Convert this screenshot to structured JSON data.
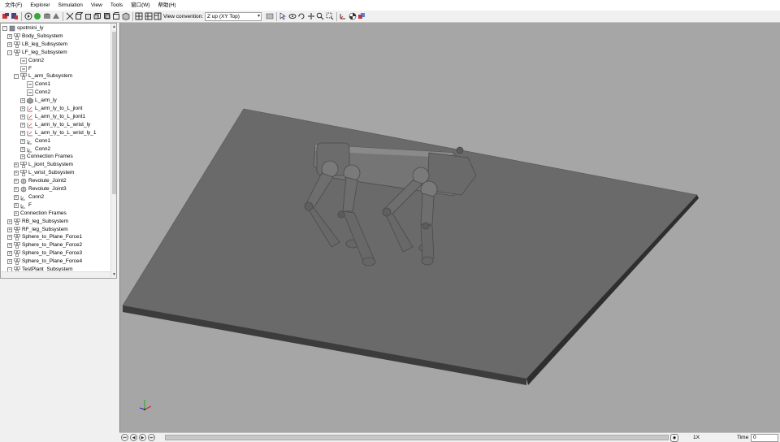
{
  "menu": [
    {
      "label": "文件(F)"
    },
    {
      "label": "Explorer"
    },
    {
      "label": "Simulation"
    },
    {
      "label": "View"
    },
    {
      "label": "Tools"
    },
    {
      "label": "窗口(W)"
    },
    {
      "label": "帮助(H)"
    }
  ],
  "toolbar": {
    "view_convention_label": "View convention:",
    "view_convention_value": "Z up (XY Top)"
  },
  "tree": [
    {
      "label": "spotmini_ly",
      "icon": "model-icon",
      "expander": "-"
    },
    {
      "label": "Body_Subsystem",
      "icon": "subsystem-icon",
      "expander": "+"
    },
    {
      "label": "LB_leg_Subsystem",
      "icon": "subsystem-icon",
      "expander": "+"
    },
    {
      "label": "LF_leg_Subsystem",
      "icon": "subsystem-icon",
      "expander": "-"
    },
    {
      "label": "Conn2",
      "icon": "port-icon",
      "expander": ""
    },
    {
      "label": "F",
      "icon": "port-icon",
      "expander": ""
    },
    {
      "label": "L_arm_Subsystem",
      "icon": "subsystem-icon",
      "expander": "-"
    },
    {
      "label": "Conn1",
      "icon": "port-icon",
      "expander": ""
    },
    {
      "label": "Conn2",
      "icon": "port-icon",
      "expander": ""
    },
    {
      "label": "L_arm_ly",
      "icon": "solid-icon",
      "expander": "+"
    },
    {
      "label": "L_arm_ly_to_L_jiont",
      "icon": "transform-icon",
      "expander": "+"
    },
    {
      "label": "L_arm_ly_to_L_jiont1",
      "icon": "transform-icon",
      "expander": "+"
    },
    {
      "label": "L_arm_ly_to_L_wrist_ly",
      "icon": "transform-icon",
      "expander": "+"
    },
    {
      "label": "L_arm_ly_to_L_wrist_ly_1",
      "icon": "transform-icon",
      "expander": "+"
    },
    {
      "label": "Conn1",
      "icon": "frame-icon",
      "expander": "+"
    },
    {
      "label": "Conn2",
      "icon": "frame-icon",
      "expander": "+"
    },
    {
      "label": "Connection Frames",
      "icon": "",
      "expander": "+"
    },
    {
      "label": "L_jiont_Subsystem",
      "icon": "subsystem-icon",
      "expander": "+"
    },
    {
      "label": "L_wrist_Subsystem",
      "icon": "subsystem-icon",
      "expander": "+"
    },
    {
      "label": "Revolute_Joint2",
      "icon": "joint-icon",
      "expander": "+"
    },
    {
      "label": "Revolute_Joint3",
      "icon": "joint-icon",
      "expander": "+"
    },
    {
      "label": "Conn2",
      "icon": "frame-icon",
      "expander": "+"
    },
    {
      "label": "F",
      "icon": "frame-icon",
      "expander": "+"
    },
    {
      "label": "Connection Frames",
      "icon": "",
      "expander": "+"
    },
    {
      "label": "RB_leg_Subsystem",
      "icon": "subsystem-icon",
      "expander": "+"
    },
    {
      "label": "RF_leg_Subsystem",
      "icon": "subsystem-icon",
      "expander": "+"
    },
    {
      "label": "Sphere_to_Plane_Force1",
      "icon": "subsystem-icon",
      "expander": "+"
    },
    {
      "label": "Sphere_to_Plane_Force2",
      "icon": "subsystem-icon",
      "expander": "+"
    },
    {
      "label": "Sphere_to_Plane_Force3",
      "icon": "subsystem-icon",
      "expander": "+"
    },
    {
      "label": "Sphere_to_Plane_Force4",
      "icon": "subsystem-icon",
      "expander": "+"
    },
    {
      "label": "TestPlant_Subsystem",
      "icon": "subsystem-icon",
      "expander": "-"
    }
  ],
  "playback": {
    "rate": "1X",
    "time_label": "Time",
    "time_value": "0"
  },
  "colors": {
    "viewport_bg": "#a6a6a6",
    "plane_top": "#6b6b6b",
    "plane_side": "#5a5a5a",
    "robot": "#6e6e6e"
  }
}
